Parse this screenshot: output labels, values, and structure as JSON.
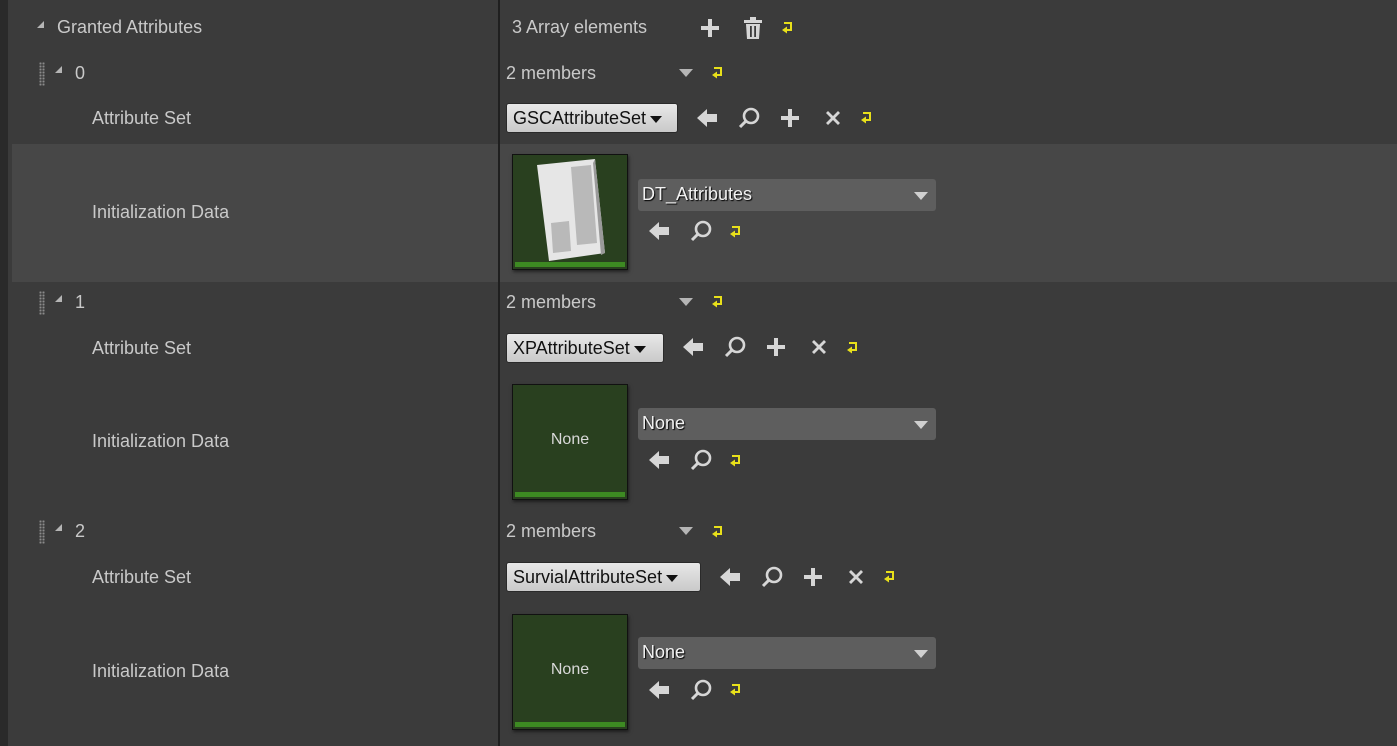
{
  "header": {
    "property_label": "Granted Attributes",
    "array_count": "3 Array elements"
  },
  "elements": [
    {
      "index": "0",
      "members": "2 members",
      "attribute_set_label": "Attribute Set",
      "attribute_set_value": "GSCAttributeSet",
      "init_label": "Initialization Data",
      "init_value": "DT_Attributes",
      "thumb_text": ""
    },
    {
      "index": "1",
      "members": "2 members",
      "attribute_set_label": "Attribute Set",
      "attribute_set_value": "XPAttributeSet",
      "init_label": "Initialization Data",
      "init_value": "None",
      "thumb_text": "None"
    },
    {
      "index": "2",
      "members": "2 members",
      "attribute_set_label": "Attribute Set",
      "attribute_set_value": "SurvialAttributeSet",
      "init_label": "Initialization Data",
      "init_value": "None",
      "thumb_text": "None"
    }
  ],
  "icons": {
    "add": "plus-icon",
    "delete": "trash-icon",
    "reset": "reset-arrow-icon",
    "use_selected": "left-arrow-icon",
    "browse": "magnifier-icon",
    "clear": "x-icon",
    "dropdown": "chevron-down-icon"
  },
  "colors": {
    "background": "#3b3b3b",
    "highlight_row": "#474747",
    "thumbnail_bg": "#29401f",
    "thumbnail_bar": "#3d8a22",
    "reset_icon": "#e8e01a"
  }
}
